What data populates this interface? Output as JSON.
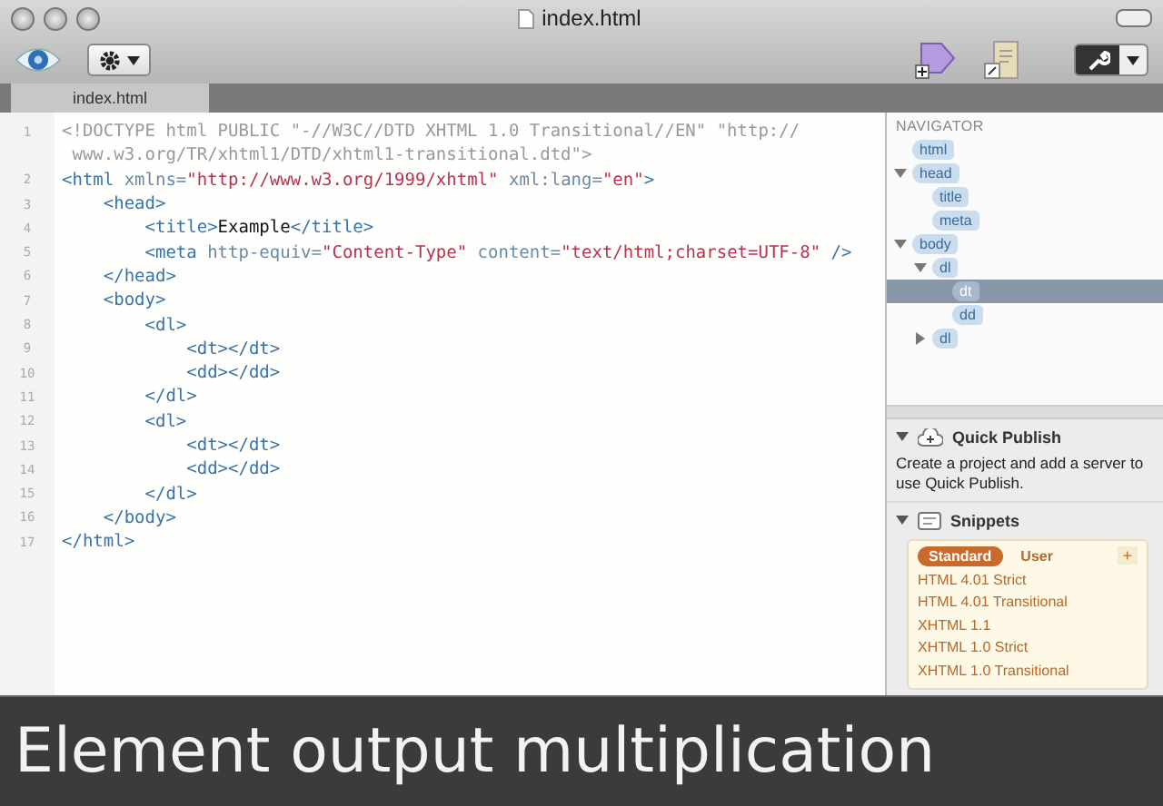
{
  "window": {
    "title": "index.html"
  },
  "tabs": [
    {
      "label": "index.html",
      "selected": true
    }
  ],
  "editor": {
    "lines": [
      {
        "number": "1",
        "tokens": [
          {
            "kind": "doctype",
            "text": "<!DOCTYPE html PUBLIC \"-//W3C//DTD XHTML 1.0 Transitional//EN\" \"http://"
          }
        ],
        "wrap_tokens": [
          {
            "kind": "doctype",
            "text": " www.w3.org/TR/xhtml1/DTD/xhtml1-transitional.dtd\">"
          }
        ]
      },
      {
        "number": "2",
        "tokens": [
          {
            "kind": "tag",
            "text": "<html"
          },
          {
            "kind": "attr",
            "text": " xmlns="
          },
          {
            "kind": "value",
            "text": "\"http://www.w3.org/1999/xhtml\""
          },
          {
            "kind": "attr",
            "text": " xml:lang="
          },
          {
            "kind": "value",
            "text": "\"en\""
          },
          {
            "kind": "tag",
            "text": ">"
          }
        ]
      },
      {
        "number": "3",
        "tokens": [
          {
            "kind": "tag",
            "text": "    <head>"
          }
        ]
      },
      {
        "number": "4",
        "tokens": [
          {
            "kind": "tag",
            "text": "        <title>"
          },
          {
            "kind": "text",
            "text": "Example"
          },
          {
            "kind": "tag",
            "text": "</title>"
          }
        ]
      },
      {
        "number": "5",
        "tokens": [
          {
            "kind": "tag",
            "text": "        <meta"
          },
          {
            "kind": "attr",
            "text": " http-equiv="
          },
          {
            "kind": "value",
            "text": "\"Content-Type\""
          },
          {
            "kind": "attr",
            "text": " content="
          },
          {
            "kind": "value",
            "text": "\"text/html;charset=UTF-8\""
          },
          {
            "kind": "tag",
            "text": " />"
          }
        ]
      },
      {
        "number": "6",
        "tokens": [
          {
            "kind": "tag",
            "text": "    </head>"
          }
        ]
      },
      {
        "number": "7",
        "tokens": [
          {
            "kind": "tag",
            "text": "    <body>"
          }
        ]
      },
      {
        "number": "8",
        "tokens": [
          {
            "kind": "tag",
            "text": "        <dl>"
          }
        ]
      },
      {
        "number": "9",
        "tokens": [
          {
            "kind": "tag",
            "text": "            <dt></dt>"
          }
        ]
      },
      {
        "number": "10",
        "tokens": [
          {
            "kind": "tag",
            "text": "            <dd></dd>"
          }
        ]
      },
      {
        "number": "11",
        "tokens": [
          {
            "kind": "tag",
            "text": "        </dl>"
          }
        ]
      },
      {
        "number": "12",
        "tokens": [
          {
            "kind": "tag",
            "text": "        <dl>"
          }
        ]
      },
      {
        "number": "13",
        "tokens": [
          {
            "kind": "tag",
            "text": "            <dt></dt>"
          }
        ]
      },
      {
        "number": "14",
        "tokens": [
          {
            "kind": "tag",
            "text": "            <dd></dd>"
          }
        ]
      },
      {
        "number": "15",
        "tokens": [
          {
            "kind": "tag",
            "text": "        </dl>"
          }
        ]
      },
      {
        "number": "16",
        "tokens": [
          {
            "kind": "tag",
            "text": "    </body>"
          }
        ]
      },
      {
        "number": "17",
        "tokens": [
          {
            "kind": "tag",
            "text": "</html>"
          }
        ]
      }
    ]
  },
  "navigator": {
    "title": "NAVIGATOR",
    "nodes": [
      {
        "label": "html",
        "selected": false
      },
      {
        "label": "head",
        "expanded": true,
        "selected": false,
        "children": [
          {
            "label": "title",
            "selected": false
          },
          {
            "label": "meta",
            "selected": false
          }
        ]
      },
      {
        "label": "body",
        "expanded": true,
        "selected": false,
        "children": [
          {
            "label": "dl",
            "expanded": true,
            "selected": false,
            "children": [
              {
                "label": "dt",
                "selected": true
              },
              {
                "label": "dd",
                "selected": false
              }
            ]
          },
          {
            "label": "dl",
            "expanded": false,
            "selected": false
          }
        ]
      }
    ]
  },
  "quick_publish": {
    "title": "Quick Publish",
    "expanded": true,
    "text": "Create a project and add a server to use Quick Publish."
  },
  "snippets": {
    "title": "Snippets",
    "expanded": true,
    "tabs": [
      {
        "label": "Standard",
        "selected": true
      },
      {
        "label": "User",
        "selected": false
      }
    ],
    "add_label": "+",
    "items": [
      "HTML 4.01 Strict",
      "HTML 4.01 Transitional",
      "XHTML 1.1",
      "XHTML 1.0 Strict",
      "XHTML 1.0 Transitional"
    ]
  },
  "caption": "Element output multiplication"
}
